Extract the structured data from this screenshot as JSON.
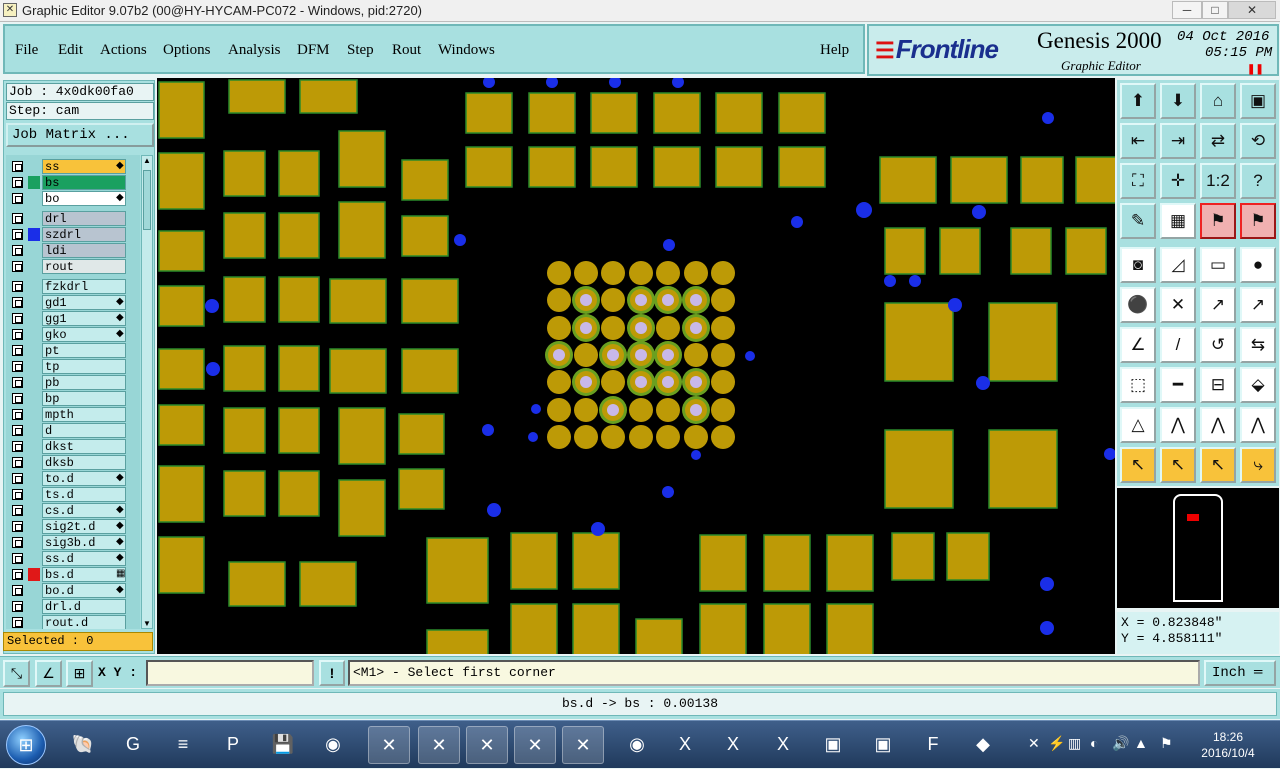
{
  "window": {
    "title": "Graphic Editor 9.07b2 (00@HY-HYCAM-PC072 - Windows, pid:2720)",
    "minimize": "─",
    "maximize": "□",
    "close": "✕"
  },
  "menu": {
    "items": [
      "File",
      "Edit",
      "Actions",
      "Options",
      "Analysis",
      "DFM",
      "Step",
      "Rout",
      "Windows"
    ],
    "help": "Help"
  },
  "brand": {
    "logo": "Frontline",
    "product": "Genesis 2000",
    "subtitle": "Graphic Editor",
    "date": "04 Oct 2016",
    "time": "05:15 PM",
    "pause_icon": "pause-icon"
  },
  "job": {
    "job_label": "Job : 4x0dk00fa0",
    "step_label": "Step: cam",
    "job_matrix": "Job Matrix ..."
  },
  "layers": [
    {
      "name": "ss",
      "color": "#f8c23a",
      "mark": "◆",
      "swatch": ""
    },
    {
      "name": "bs",
      "color": "#1aa060",
      "mark": "",
      "swatch": "#1aa060"
    },
    {
      "name": "bo",
      "color": "#ffffff",
      "mark": "◆",
      "swatch": ""
    },
    {
      "name": "drl",
      "color": "#b8c4d0",
      "mark": "",
      "swatch": ""
    },
    {
      "name": "szdrl",
      "color": "#b8c4d0",
      "mark": "",
      "swatch": "#1a2ee8"
    },
    {
      "name": "ldi",
      "color": "#b8c4d0",
      "mark": "",
      "swatch": ""
    },
    {
      "name": "rout",
      "color": "#e0e8e8",
      "mark": "",
      "swatch": ""
    },
    {
      "name": "fzkdrl",
      "color": "#c4ecec",
      "mark": "",
      "swatch": ""
    },
    {
      "name": "gd1",
      "color": "#c4ecec",
      "mark": "◆",
      "swatch": ""
    },
    {
      "name": "gg1",
      "color": "#c4ecec",
      "mark": "◆",
      "swatch": ""
    },
    {
      "name": "gko",
      "color": "#c4ecec",
      "mark": "◆",
      "swatch": ""
    },
    {
      "name": "pt",
      "color": "#c4ecec",
      "mark": "",
      "swatch": ""
    },
    {
      "name": "tp",
      "color": "#c4ecec",
      "mark": "",
      "swatch": ""
    },
    {
      "name": "pb",
      "color": "#c4ecec",
      "mark": "",
      "swatch": ""
    },
    {
      "name": "bp",
      "color": "#c4ecec",
      "mark": "",
      "swatch": ""
    },
    {
      "name": "mpth",
      "color": "#c4ecec",
      "mark": "",
      "swatch": ""
    },
    {
      "name": "d",
      "color": "#c4ecec",
      "mark": "",
      "swatch": ""
    },
    {
      "name": "dkst",
      "color": "#c4ecec",
      "mark": "",
      "swatch": ""
    },
    {
      "name": "dksb",
      "color": "#c4ecec",
      "mark": "",
      "swatch": ""
    },
    {
      "name": "to.d",
      "color": "#c4ecec",
      "mark": "◆",
      "swatch": ""
    },
    {
      "name": "ts.d",
      "color": "#c4ecec",
      "mark": "",
      "swatch": ""
    },
    {
      "name": "cs.d",
      "color": "#c4ecec",
      "mark": "◆",
      "swatch": ""
    },
    {
      "name": "sig2t.d",
      "color": "#c4ecec",
      "mark": "◆",
      "swatch": ""
    },
    {
      "name": "sig3b.d",
      "color": "#c4ecec",
      "mark": "◆",
      "swatch": ""
    },
    {
      "name": "ss.d",
      "color": "#c4ecec",
      "mark": "◆",
      "swatch": ""
    },
    {
      "name": "bs.d",
      "color": "#c4ecec",
      "mark": "▦",
      "swatch": "#e01818"
    },
    {
      "name": "bo.d",
      "color": "#c4ecec",
      "mark": "◆",
      "swatch": ""
    },
    {
      "name": "drl.d",
      "color": "#c4ecec",
      "mark": "",
      "swatch": ""
    },
    {
      "name": "rout.d",
      "color": "#c4ecec",
      "mark": "",
      "swatch": ""
    }
  ],
  "selected": "Selected : 0",
  "coords": {
    "x": "X = 0.823848\"",
    "y": "Y = 4.858111\""
  },
  "command": {
    "xy_label": "X Y :",
    "xy_value": "",
    "prompt": "<M1> - Select first corner",
    "unit": "Inch ═"
  },
  "status": "bs.d -> bs : 0.00138",
  "tools": [
    "zoom-home-icon",
    "zoom-out-icon",
    "home-view-icon",
    "fit-icon",
    "pan-left-icon",
    "pan-right-icon",
    "swap-icon",
    "redraw-icon",
    "zoom-box-icon",
    "center-icon",
    "scale-1-2-icon",
    "help-query-icon",
    "measure-icon",
    "grid-icon",
    "layer-red-icon",
    "layer-red2-icon",
    "pad-icon",
    "polygon-icon",
    "ruler-icon",
    "circle-icon",
    "node-icon",
    "cross-icon",
    "vector-icon",
    "vector2-icon",
    "line-icon",
    "line2-icon",
    "arc-icon",
    "flip-icon",
    "snap-icon",
    "split-icon",
    "fit2-icon",
    "group-icon",
    "triangle-icon",
    "triangle2-icon",
    "triangle3-icon",
    "triangle4-icon",
    "select-icon",
    "select2-icon",
    "select3-icon",
    "route-icon"
  ],
  "tool_glyphs": [
    "⬆",
    "⬇",
    "⌂",
    "▣",
    "⇤",
    "⇥",
    "⇄",
    "⟲",
    "⛶",
    "✛",
    "1:2",
    "?",
    "✎",
    "▦",
    "⚑",
    "⚑",
    "◙",
    "◿",
    "▭",
    "●",
    "⚫",
    "✕",
    "↗",
    "↗",
    "∠",
    "/",
    "↺",
    "⇆",
    "⬚",
    "━",
    "⊟",
    "⬙",
    "△",
    "⋀",
    "⋀",
    "⋀",
    "↖",
    "↖",
    "↖",
    "⤷"
  ],
  "taskbar": {
    "start": "⊞",
    "apps": [
      "🐚",
      "G",
      "≡",
      "P",
      "💾",
      "◉",
      "✕",
      "✕",
      "✕",
      "✕",
      "✕",
      "◉",
      "X",
      "X",
      "X",
      "▣",
      "▣",
      "F",
      "◆"
    ],
    "tray": [
      "✕",
      "⚡",
      "▥",
      "◐",
      "🔊",
      "▲",
      "⚑"
    ],
    "time": "18:26",
    "date": "2016/10/4"
  }
}
